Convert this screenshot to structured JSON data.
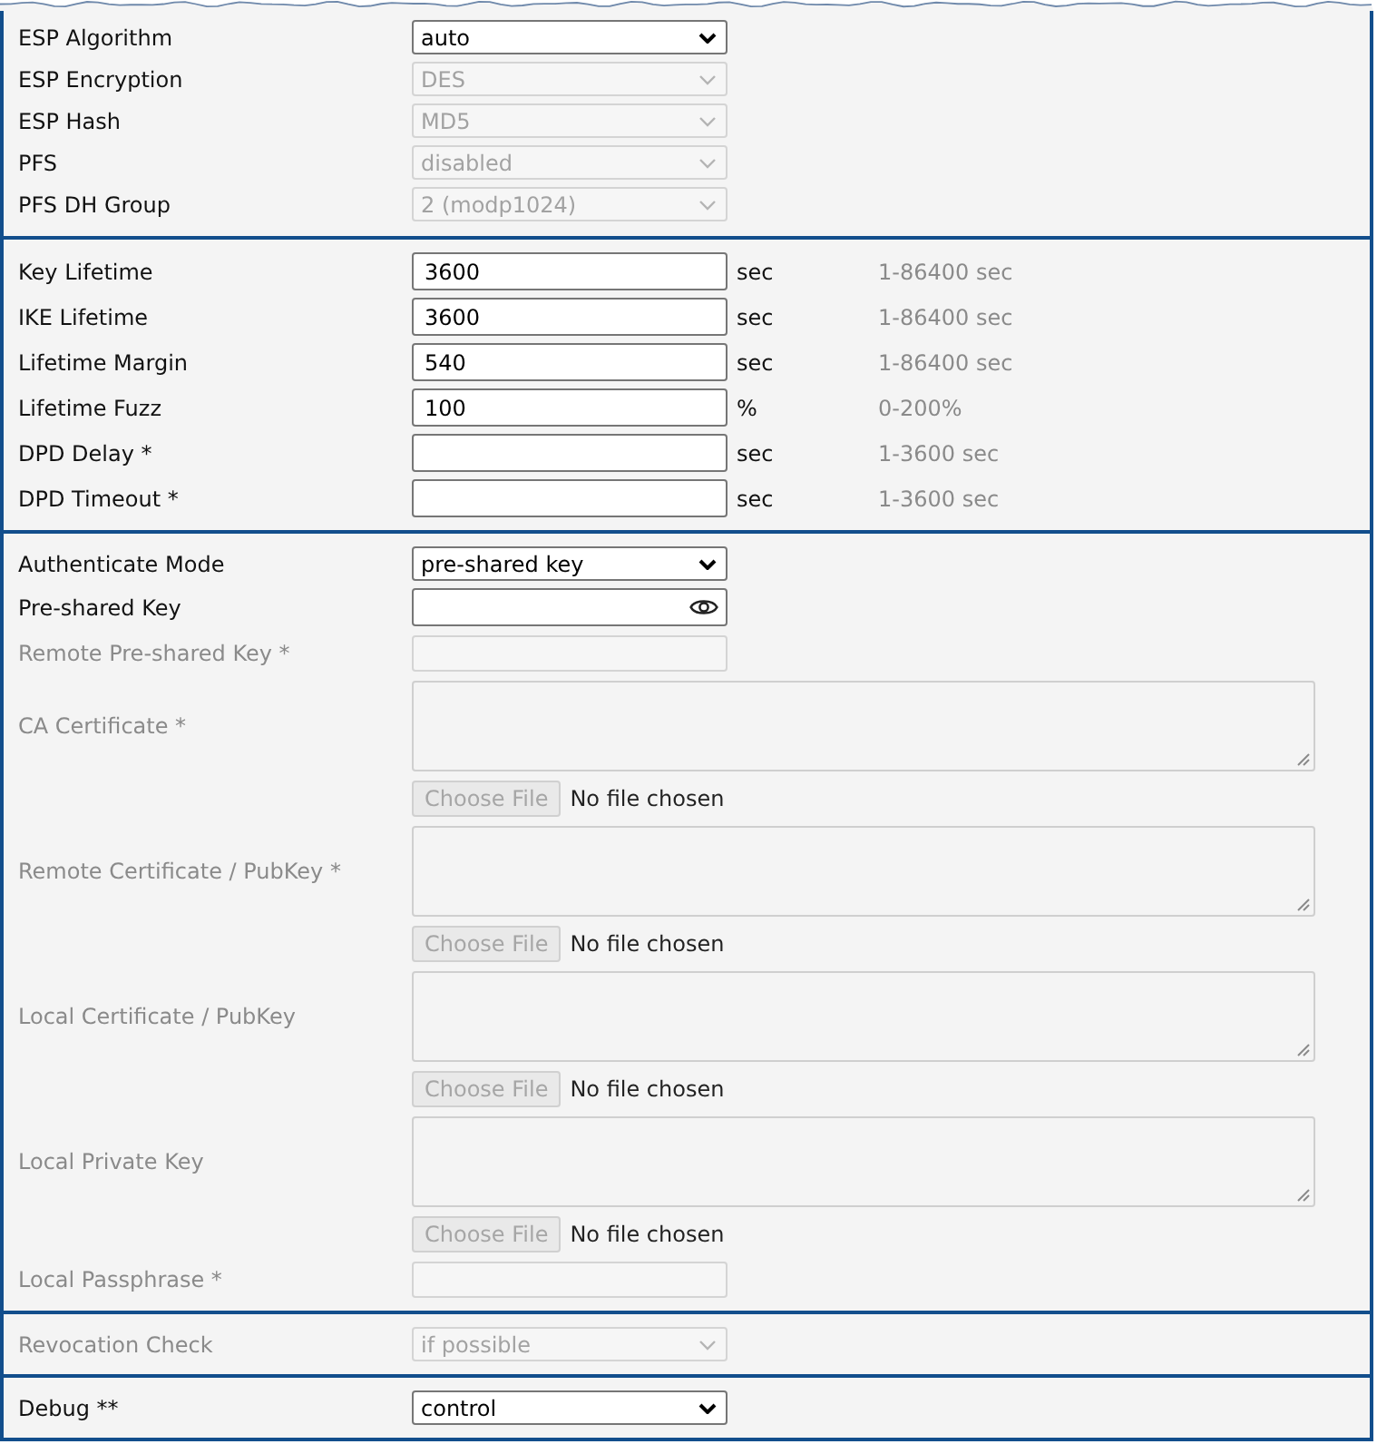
{
  "sections": [
    {
      "rows": [
        {
          "kind": "select",
          "label": "ESP Algorithm",
          "label_disabled": false,
          "value": "auto",
          "disabled": false
        },
        {
          "kind": "select",
          "label": "ESP Encryption",
          "label_disabled": false,
          "value": "DES",
          "disabled": true
        },
        {
          "kind": "select",
          "label": "ESP Hash",
          "label_disabled": false,
          "value": "MD5",
          "disabled": true
        },
        {
          "kind": "select",
          "label": "PFS",
          "label_disabled": false,
          "value": "disabled",
          "disabled": true
        },
        {
          "kind": "select",
          "label": "PFS DH Group",
          "label_disabled": false,
          "value": "2 (modp1024)",
          "disabled": true
        }
      ]
    },
    {
      "rows": [
        {
          "kind": "text",
          "label": "Key Lifetime",
          "label_disabled": false,
          "value": "3600",
          "disabled": false,
          "unit": "sec",
          "hint": "1-86400 sec"
        },
        {
          "kind": "text",
          "label": "IKE Lifetime",
          "label_disabled": false,
          "value": "3600",
          "disabled": false,
          "unit": "sec",
          "hint": "1-86400 sec"
        },
        {
          "kind": "text",
          "label": "Lifetime Margin",
          "label_disabled": false,
          "value": "540",
          "disabled": false,
          "unit": "sec",
          "hint": "1-86400 sec"
        },
        {
          "kind": "text",
          "label": "Lifetime Fuzz",
          "label_disabled": false,
          "value": "100",
          "disabled": false,
          "unit": "%",
          "hint": "0-200%"
        },
        {
          "kind": "text",
          "label": "DPD Delay *",
          "label_disabled": false,
          "disabled": false,
          "unit": "sec",
          "hint": "1-3600 sec"
        },
        {
          "kind": "text",
          "label": "DPD Timeout *",
          "label_disabled": false,
          "disabled": false,
          "unit": "sec",
          "hint": "1-3600 sec"
        }
      ]
    },
    {
      "rows": [
        {
          "kind": "select",
          "label": "Authenticate Mode",
          "label_disabled": false,
          "value": "pre-shared key",
          "disabled": false
        },
        {
          "kind": "password",
          "label": "Pre-shared Key",
          "label_disabled": false,
          "disabled": false
        },
        {
          "kind": "text",
          "label": "Remote Pre-shared Key *",
          "label_disabled": true,
          "disabled": true
        },
        {
          "kind": "textarea",
          "label": "CA Certificate *",
          "label_disabled": true,
          "disabled": true,
          "file_button": "Choose File",
          "file_status": "No file chosen"
        },
        {
          "kind": "textarea",
          "label": "Remote Certificate / PubKey *",
          "label_disabled": true,
          "disabled": true,
          "file_button": "Choose File",
          "file_status": "No file chosen"
        },
        {
          "kind": "textarea",
          "label": "Local Certificate / PubKey",
          "label_disabled": true,
          "disabled": true,
          "file_button": "Choose File",
          "file_status": "No file chosen"
        },
        {
          "kind": "textarea",
          "label": "Local Private Key",
          "label_disabled": true,
          "disabled": true,
          "file_button": "Choose File",
          "file_status": "No file chosen"
        },
        {
          "kind": "text",
          "label": "Local Passphrase *",
          "label_disabled": true,
          "disabled": true
        }
      ]
    },
    {
      "rows": [
        {
          "kind": "select",
          "label": "Revocation Check",
          "label_disabled": true,
          "value": "if possible",
          "disabled": true
        }
      ]
    },
    {
      "rows": [
        {
          "kind": "select",
          "label": "Debug **",
          "label_disabled": false,
          "value": "control",
          "disabled": false
        }
      ]
    }
  ]
}
